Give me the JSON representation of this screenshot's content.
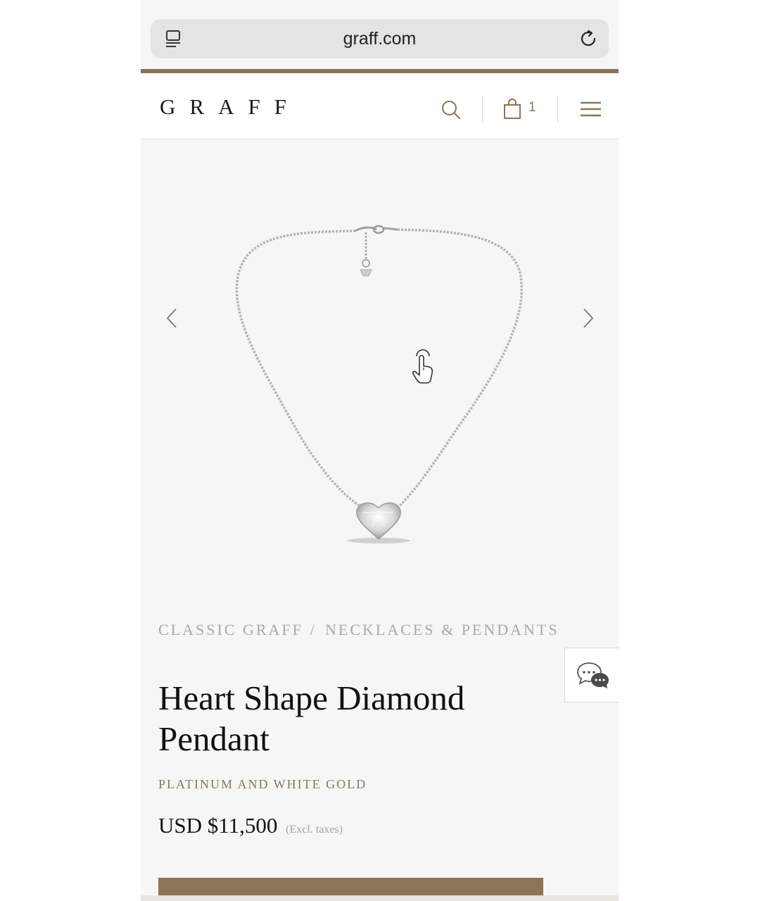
{
  "browser": {
    "url": "graff.com",
    "tabs_icon": "tabs-icon",
    "reload_icon": "reload-icon"
  },
  "header": {
    "logo": "GRAFF",
    "search_icon": "search-icon",
    "bag_icon": "shopping-bag-icon",
    "bag_count": "1",
    "menu_icon": "hamburger-menu-icon"
  },
  "gallery": {
    "prev_icon": "chevron-left-icon",
    "next_icon": "chevron-right-icon",
    "image": "heart-shape-diamond-pendant-necklace",
    "hint_icon": "tap-hand-icon"
  },
  "breadcrumb": {
    "items": [
      "CLASSIC GRAFF",
      "NECKLACES & PENDANTS"
    ],
    "separator": "/"
  },
  "chat": {
    "icon": "chat-bubbles-icon"
  },
  "product": {
    "title": "Heart Shape Diamond Pendant",
    "material": "PLATINUM AND WHITE GOLD",
    "price": "USD $11,500",
    "tax_note": "(Excl. taxes)"
  },
  "colors": {
    "brand": "#8b7556",
    "background": "#f6f6f6",
    "text": "#111111",
    "muted": "#a9a9a9"
  }
}
